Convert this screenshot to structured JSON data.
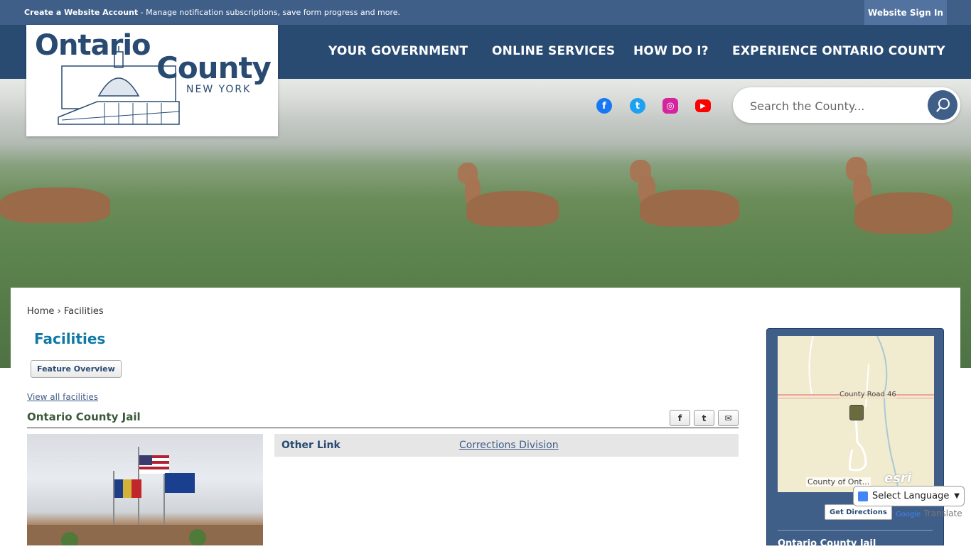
{
  "topbar": {
    "create_account": "Create a Website Account",
    "message": " - Manage notification subscriptions, save form progress and more.",
    "sign_in": "Website Sign In"
  },
  "logo": {
    "line1": "Ontario",
    "line2": "County",
    "line3": "NEW YORK"
  },
  "nav": [
    "YOUR GOVERNMENT",
    "ONLINE SERVICES",
    "HOW DO I?",
    "EXPERIENCE ONTARIO COUNTY"
  ],
  "social": [
    {
      "name": "facebook-icon",
      "glyph": "f",
      "color": "#1877f2"
    },
    {
      "name": "twitter-icon",
      "glyph": "t",
      "color": "#1da1f2"
    },
    {
      "name": "instagram-icon",
      "glyph": "◎",
      "color": "#d6249f"
    },
    {
      "name": "youtube-icon",
      "glyph": "▶",
      "color": "#ff0000"
    }
  ],
  "search": {
    "placeholder": "Search the County..."
  },
  "breadcrumb": {
    "home": "Home",
    "separator": "›",
    "current": "Facilities"
  },
  "page": {
    "title": "Facilities",
    "feature_overview": "Feature Overview",
    "view_all": "View all facilities",
    "facility_title": "Ontario County Jail"
  },
  "share": {
    "facebook": "f",
    "twitter": "t",
    "email": "✉"
  },
  "details": {
    "label": "Other Link",
    "link": "Corrections Division"
  },
  "map": {
    "road_label": "County Road 46",
    "attribution": "County of Ont...",
    "esri": "esri"
  },
  "sidebar": {
    "directions": "Get Directions",
    "title": "Ontario County Jail"
  },
  "translate": {
    "select": "Select Language",
    "powered_google": "Google",
    "powered_translate": "Translate"
  },
  "colors": {
    "primary": "#294b72",
    "accent": "#3f5f89",
    "title": "#0f78a4"
  }
}
